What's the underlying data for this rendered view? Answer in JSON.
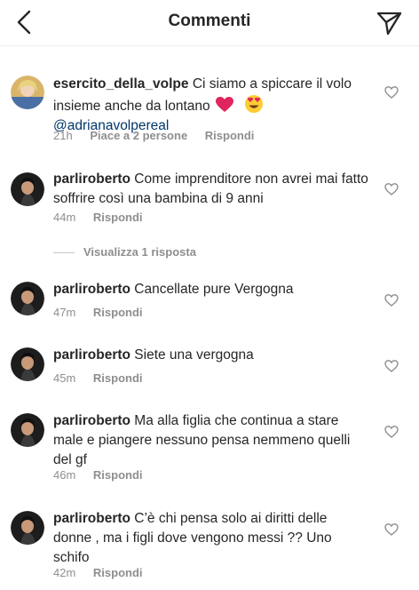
{
  "header": {
    "title": "Commenti",
    "back_icon": "chevron-left-icon",
    "share_icon": "paper-plane-icon"
  },
  "comments": [
    {
      "username": "esercito_della_volpe",
      "text": "Ci siamo a spiccare il volo insieme anche da lontano",
      "emojis": [
        "red-heart-icon",
        "heart-eyes-face-icon"
      ],
      "mention": "@adrianavolpereal",
      "time": "21h",
      "likes": "Piace a 2 persone",
      "reply": "Rispondi"
    },
    {
      "username": "parliroberto",
      "text": "Come imprenditore non avrei mai fatto soffrire così una bambina di 9 anni",
      "time": "44m",
      "reply": "Rispondi"
    },
    {
      "username": "parliroberto",
      "text": "Cancellate pure Vergogna",
      "time": "47m",
      "reply": "Rispondi"
    },
    {
      "username": "parliroberto",
      "text": "Siete una vergogna",
      "time": "45m",
      "reply": "Rispondi"
    },
    {
      "username": "parliroberto",
      "text": "Ma alla figlia che continua a stare male e piangere nessuno pensa nemmeno quelli del gf",
      "time": "46m",
      "reply": "Rispondi"
    },
    {
      "username": "parliroberto",
      "text": "C’è chi pensa solo ai diritti delle donne , ma i figli dove vengono messi ?? Uno schifo",
      "time": "42m",
      "reply": "Rispondi"
    }
  ],
  "replies_toggle": "Visualizza 1 risposta",
  "colors": {
    "text": "#262626",
    "secondary": "#8e8e8e",
    "mention": "#00376b",
    "heart": "#e0245e",
    "divider": "#efefef"
  }
}
